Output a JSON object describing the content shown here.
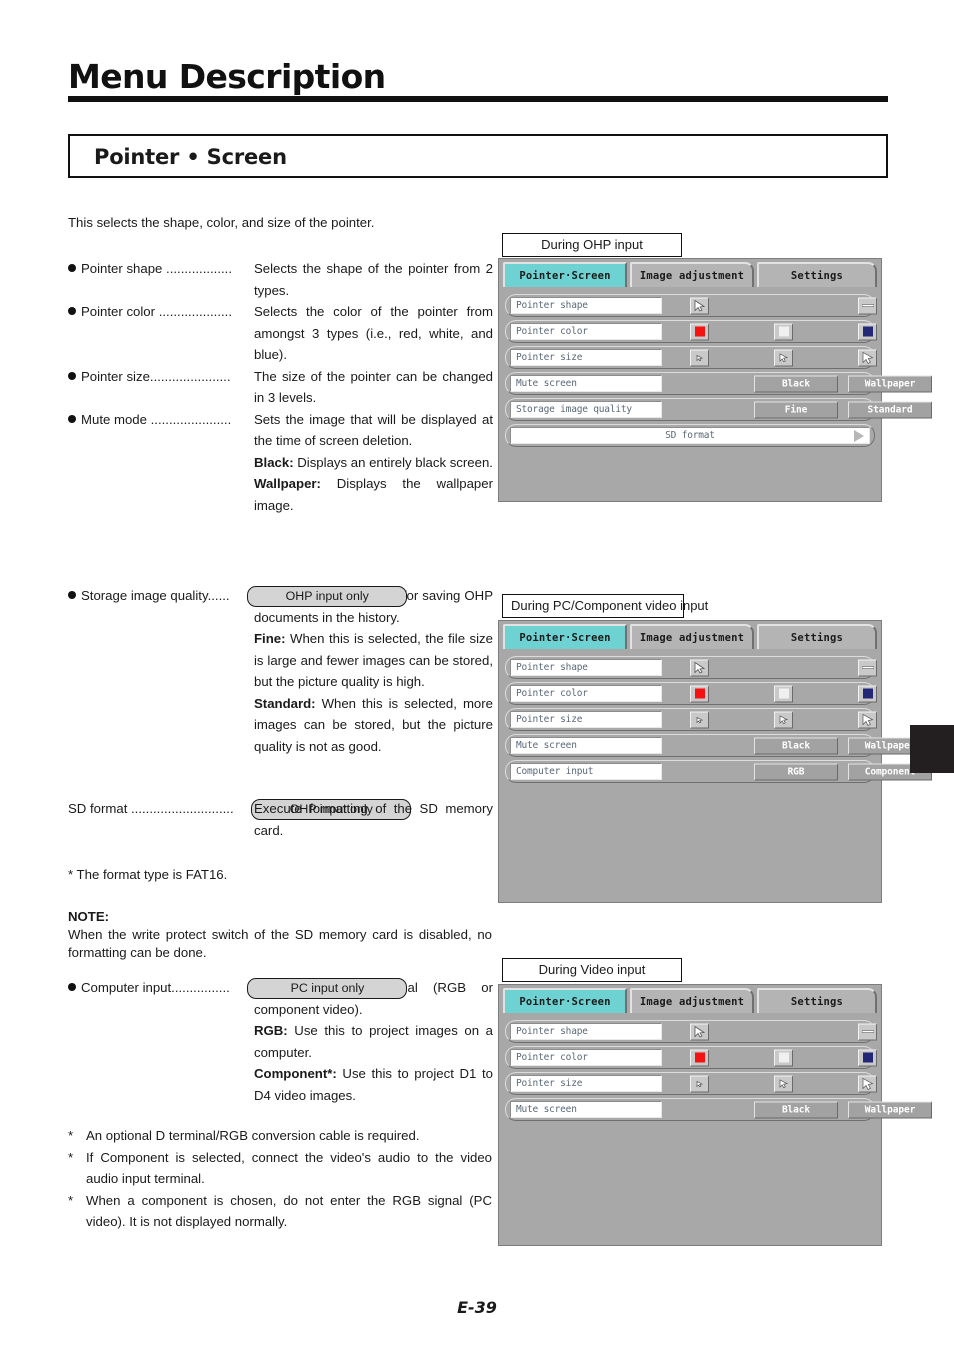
{
  "header": {
    "title": "Menu Description",
    "section": "Pointer • Screen"
  },
  "intro": "This selects the shape, color, and size of the pointer.",
  "definitions": [
    {
      "term": "Pointer shape",
      "dots": " ..................",
      "desc": "Selects the shape of the pointer from 2 types."
    },
    {
      "term": "Pointer color",
      "dots": " ....................",
      "desc": "Selects the color of the pointer from amongst 3 types (i.e., red, white, and blue)."
    },
    {
      "term": "Pointer size",
      "dots": "......................",
      "desc": "The size of the pointer can be changed in 3 levels."
    },
    {
      "term": "Mute mode",
      "dots": " ......................",
      "desc": "Sets the image that will be displayed at the time of screen deletion."
    }
  ],
  "mute_mode_details": [
    {
      "label": "Black:",
      "text": " Displays an entirely black screen."
    },
    {
      "label": "Wallpaper:",
      "text": " Displays the wallpaper image."
    }
  ],
  "storage": {
    "term": "Storage image quality",
    "dots": "......",
    "badge": "OHP input only",
    "desc": "Select the picture quality for saving OHP documents in the history.",
    "details": [
      {
        "label": "Fine:",
        "text": " When this is selected, the file size is large and fewer images can be stored, but the picture quality is high."
      },
      {
        "label": "Standard:",
        "text": " When this is selected, more images can be stored, but the picture quality is not as good."
      }
    ]
  },
  "sd_format": {
    "term": "SD format",
    "dots": " ............................",
    "badge": "OHP input only",
    "desc": "Execute formatting of the SD memory card.",
    "footnote": "*  The format type is FAT16."
  },
  "note": {
    "title": "NOTE:",
    "body": "When the write protect switch of the SD memory card is disabled, no formatting can be done."
  },
  "computer_input": {
    "term": "Computer input",
    "dots": "................",
    "badge": "PC input only",
    "desc": "Select the input signal (RGB or component video).",
    "details": [
      {
        "label": "RGB:",
        "text": " Use this to project images on a computer."
      },
      {
        "label": "Component*:",
        "text": " Use this to project D1 to D4 video images."
      }
    ]
  },
  "footnotes": [
    {
      "star": "*",
      "text": "An optional D terminal/RGB conversion cable is required."
    },
    {
      "star": "*",
      "text": "If Component is selected, connect the video's audio to the video audio input terminal."
    },
    {
      "star": "*",
      "text": "When a component is chosen, do not enter the RGB signal (PC video). It is not displayed normally."
    }
  ],
  "page_number": "E-39",
  "colors": {
    "active_tab": "#6ed2d2",
    "panel_bg": "#a8a8a8",
    "pointer_red": "#f41212",
    "pointer_white": "#f0f0f0",
    "pointer_blue": "#232876",
    "label_text": "#5b6878"
  },
  "osd_tabs": {
    "tab1": "Pointer·Screen",
    "tab2": "Image adjustment",
    "tab3": "Settings"
  },
  "osd_panels": [
    {
      "caption": "During OHP input",
      "rows": [
        {
          "type": "icons",
          "label": "Pointer shape",
          "icons": [
            "pointer-arrow-icon",
            "",
            "pointer-dash-icon"
          ]
        },
        {
          "type": "icons",
          "label": "Pointer color",
          "icons": [
            "swatch-red",
            "swatch-white",
            "swatch-blue"
          ]
        },
        {
          "type": "icons",
          "label": "Pointer size",
          "icons": [
            "arrow-small-icon",
            "arrow-medium-icon",
            "arrow-large-icon"
          ]
        },
        {
          "type": "buttons",
          "label": "Mute screen",
          "buttons": [
            "Black",
            "Wallpaper"
          ]
        },
        {
          "type": "buttons",
          "label": "Storage image quality",
          "buttons": [
            "Fine",
            "Standard"
          ]
        },
        {
          "type": "wide",
          "label": "SD format"
        }
      ]
    },
    {
      "caption": "During PC/Component video input",
      "rows": [
        {
          "type": "icons",
          "label": "Pointer shape",
          "icons": [
            "pointer-arrow-icon",
            "",
            "pointer-dash-icon"
          ]
        },
        {
          "type": "icons",
          "label": "Pointer color",
          "icons": [
            "swatch-red",
            "swatch-white",
            "swatch-blue"
          ]
        },
        {
          "type": "icons",
          "label": "Pointer size",
          "icons": [
            "arrow-small-icon",
            "arrow-medium-icon",
            "arrow-large-icon"
          ]
        },
        {
          "type": "buttons",
          "label": "Mute screen",
          "buttons": [
            "Black",
            "Wallpaper"
          ]
        },
        {
          "type": "buttons",
          "label": "Computer input",
          "buttons": [
            "RGB",
            "Component"
          ]
        }
      ]
    },
    {
      "caption": "During Video input",
      "rows": [
        {
          "type": "icons",
          "label": "Pointer shape",
          "icons": [
            "pointer-arrow-icon",
            "",
            "pointer-dash-icon"
          ]
        },
        {
          "type": "icons",
          "label": "Pointer color",
          "icons": [
            "swatch-red",
            "swatch-white",
            "swatch-blue"
          ]
        },
        {
          "type": "icons",
          "label": "Pointer size",
          "icons": [
            "arrow-small-icon",
            "arrow-medium-icon",
            "arrow-large-icon"
          ]
        },
        {
          "type": "buttons",
          "label": "Mute screen",
          "buttons": [
            "Black",
            "Wallpaper"
          ]
        }
      ]
    }
  ]
}
